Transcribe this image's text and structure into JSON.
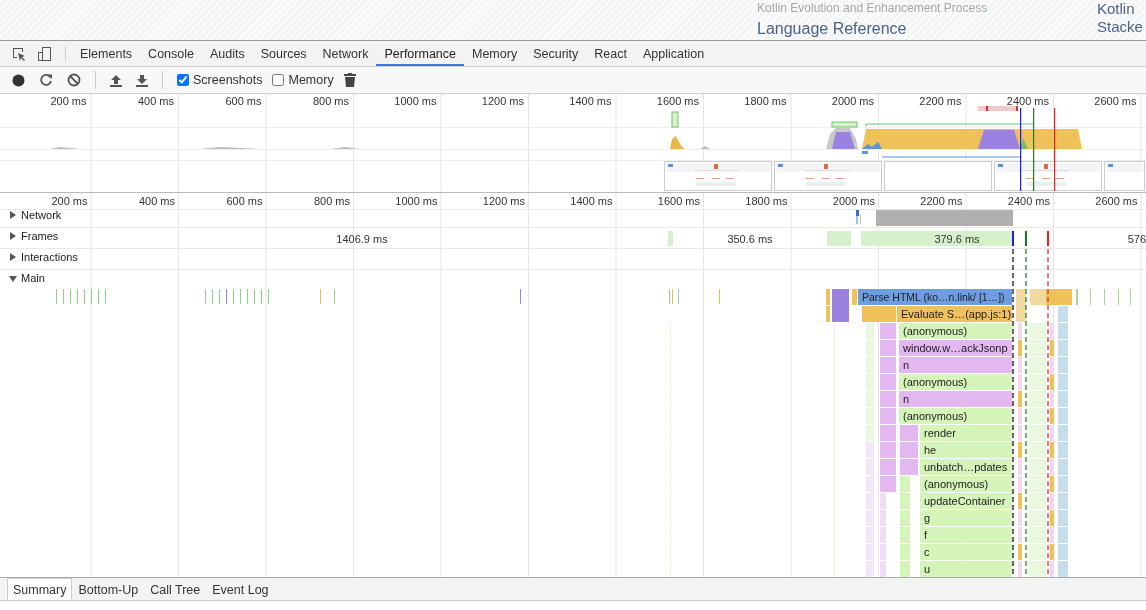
{
  "background_page": {
    "links": [
      {
        "text": "Kotlin Evolution and Enhancement Process"
      },
      {
        "text": "Language Reference"
      }
    ],
    "side_links": [
      {
        "text": "Kotlin"
      },
      {
        "text": "Stacke"
      }
    ]
  },
  "panel_tabs": [
    {
      "label": "Elements",
      "selected": false
    },
    {
      "label": "Console",
      "selected": false
    },
    {
      "label": "Audits",
      "selected": false
    },
    {
      "label": "Sources",
      "selected": false
    },
    {
      "label": "Network",
      "selected": false
    },
    {
      "label": "Performance",
      "selected": true
    },
    {
      "label": "Memory",
      "selected": false
    },
    {
      "label": "Security",
      "selected": false
    },
    {
      "label": "React",
      "selected": false
    },
    {
      "label": "Application",
      "selected": false
    }
  ],
  "toolbar": {
    "options": [
      {
        "label": "Screenshots",
        "checked": true
      },
      {
        "label": "Memory",
        "checked": false
      }
    ]
  },
  "overview": {
    "ticks": [
      "200 ms",
      "400 ms",
      "600 ms",
      "800 ms",
      "1000 ms",
      "1200 ms",
      "1400 ms",
      "1600 ms",
      "1800 ms",
      "2000 ms",
      "2200 ms",
      "2400 ms",
      "2600 ms"
    ]
  },
  "timeline": {
    "ticks": [
      "200 ms",
      "400 ms",
      "600 ms",
      "800 ms",
      "1000 ms",
      "1200 ms",
      "1400 ms",
      "1600 ms",
      "1800 ms",
      "2000 ms",
      "2200 ms",
      "2400 ms",
      "2600 ms"
    ],
    "tracks": [
      {
        "label": "Network",
        "expanded": false
      },
      {
        "label": "Frames",
        "expanded": false
      },
      {
        "label": "Interactions",
        "expanded": false
      },
      {
        "label": "Main",
        "expanded": true
      }
    ],
    "frames": [
      {
        "duration": "1406.9 ms"
      },
      {
        "duration": "350.6 ms"
      },
      {
        "duration": "379.6 ms"
      },
      {
        "duration": "576"
      }
    ],
    "flame": [
      {
        "name": "Parse HTML (ko…n.link/ [1…])",
        "color": "#6f9ee0"
      },
      {
        "name": "Evaluate S…(app.js:1)",
        "color": "#f0c05a"
      },
      {
        "name": "(anonymous)",
        "color": "#d5f4b9"
      },
      {
        "name": "window.w…ackJsonp",
        "color": "#e3b8f1"
      },
      {
        "name": "n",
        "color": "#e3b8f1"
      },
      {
        "name": "(anonymous)",
        "color": "#d5f4b9"
      },
      {
        "name": "n",
        "color": "#e3b8f1"
      },
      {
        "name": "(anonymous)",
        "color": "#d5f4b9"
      },
      {
        "name": "render",
        "color": "#d5f4b9"
      },
      {
        "name": "he",
        "color": "#d5f4b9"
      },
      {
        "name": "unbatch…pdates",
        "color": "#d5f4b9"
      },
      {
        "name": "(anonymous)",
        "color": "#d5f4b9"
      },
      {
        "name": "updateContainer",
        "color": "#d5f4b9"
      },
      {
        "name": "g",
        "color": "#d5f4b9"
      },
      {
        "name": "f",
        "color": "#d5f4b9"
      },
      {
        "name": "c",
        "color": "#d5f4b9"
      },
      {
        "name": "u",
        "color": "#d5f4b9"
      }
    ]
  },
  "details_tabs": [
    {
      "label": "Summary",
      "selected": true
    },
    {
      "label": "Bottom-Up",
      "selected": false
    },
    {
      "label": "Call Tree",
      "selected": false
    },
    {
      "label": "Event Log",
      "selected": false
    }
  ]
}
